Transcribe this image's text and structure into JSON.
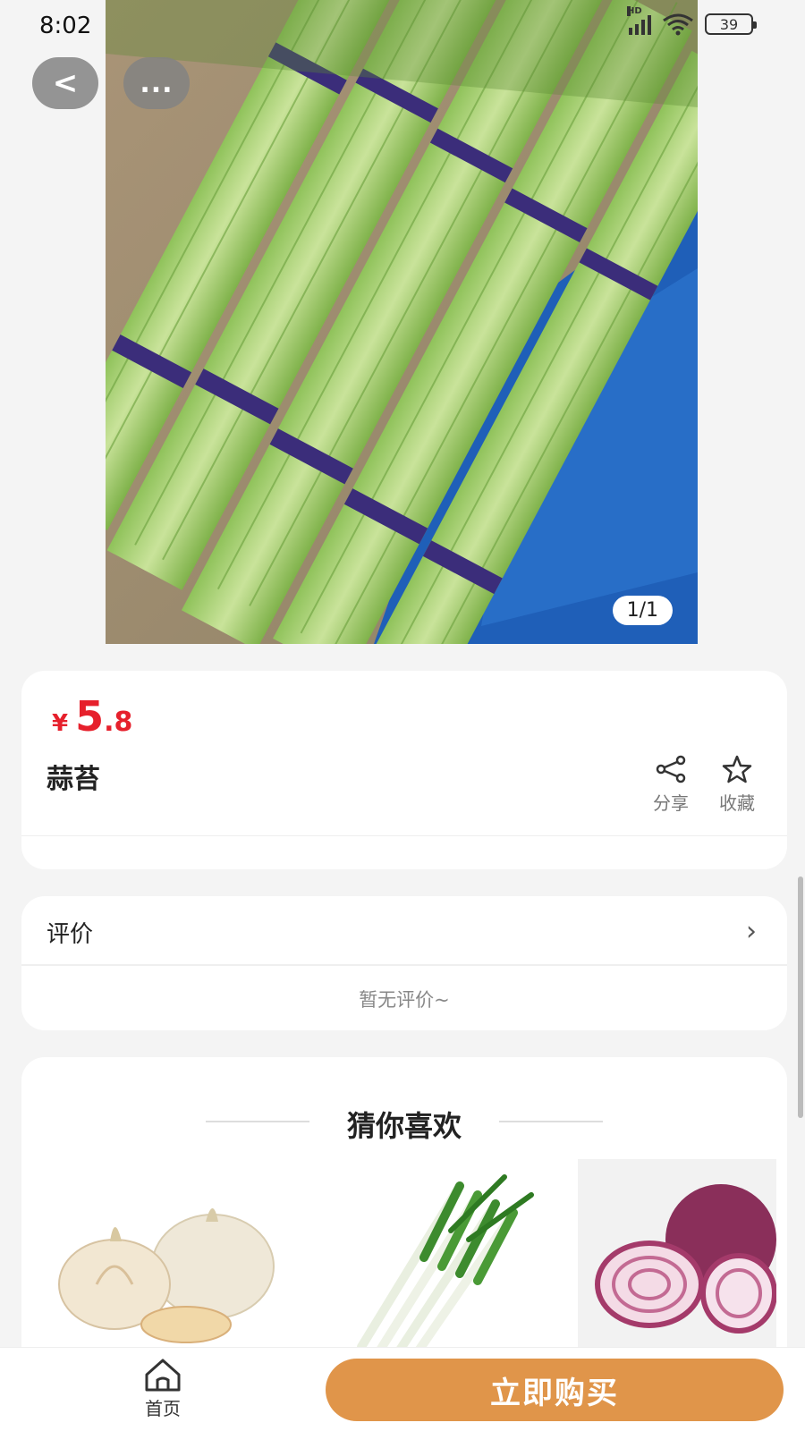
{
  "status_bar": {
    "time": "8:02",
    "battery": "39",
    "network_label": "HD"
  },
  "nav": {
    "back_label": "<",
    "more_label": "..."
  },
  "gallery": {
    "counter": "1/1"
  },
  "product": {
    "currency": "¥",
    "price_int": "5",
    "price_dec": ".8",
    "name": "蒜苔",
    "share_label": "分享",
    "favorite_label": "收藏",
    "price_color": "#e6202c"
  },
  "reviews": {
    "title": "评价",
    "empty_text": "暂无评价~"
  },
  "recommendations": {
    "title": "猜你喜欢",
    "items": [
      {
        "icon": "garlic-image"
      },
      {
        "icon": "scallion-image"
      },
      {
        "icon": "red-onion-image"
      }
    ]
  },
  "bottom_bar": {
    "home_label": "首页",
    "buy_label": "立即购买",
    "buy_color": "#e0954a"
  }
}
